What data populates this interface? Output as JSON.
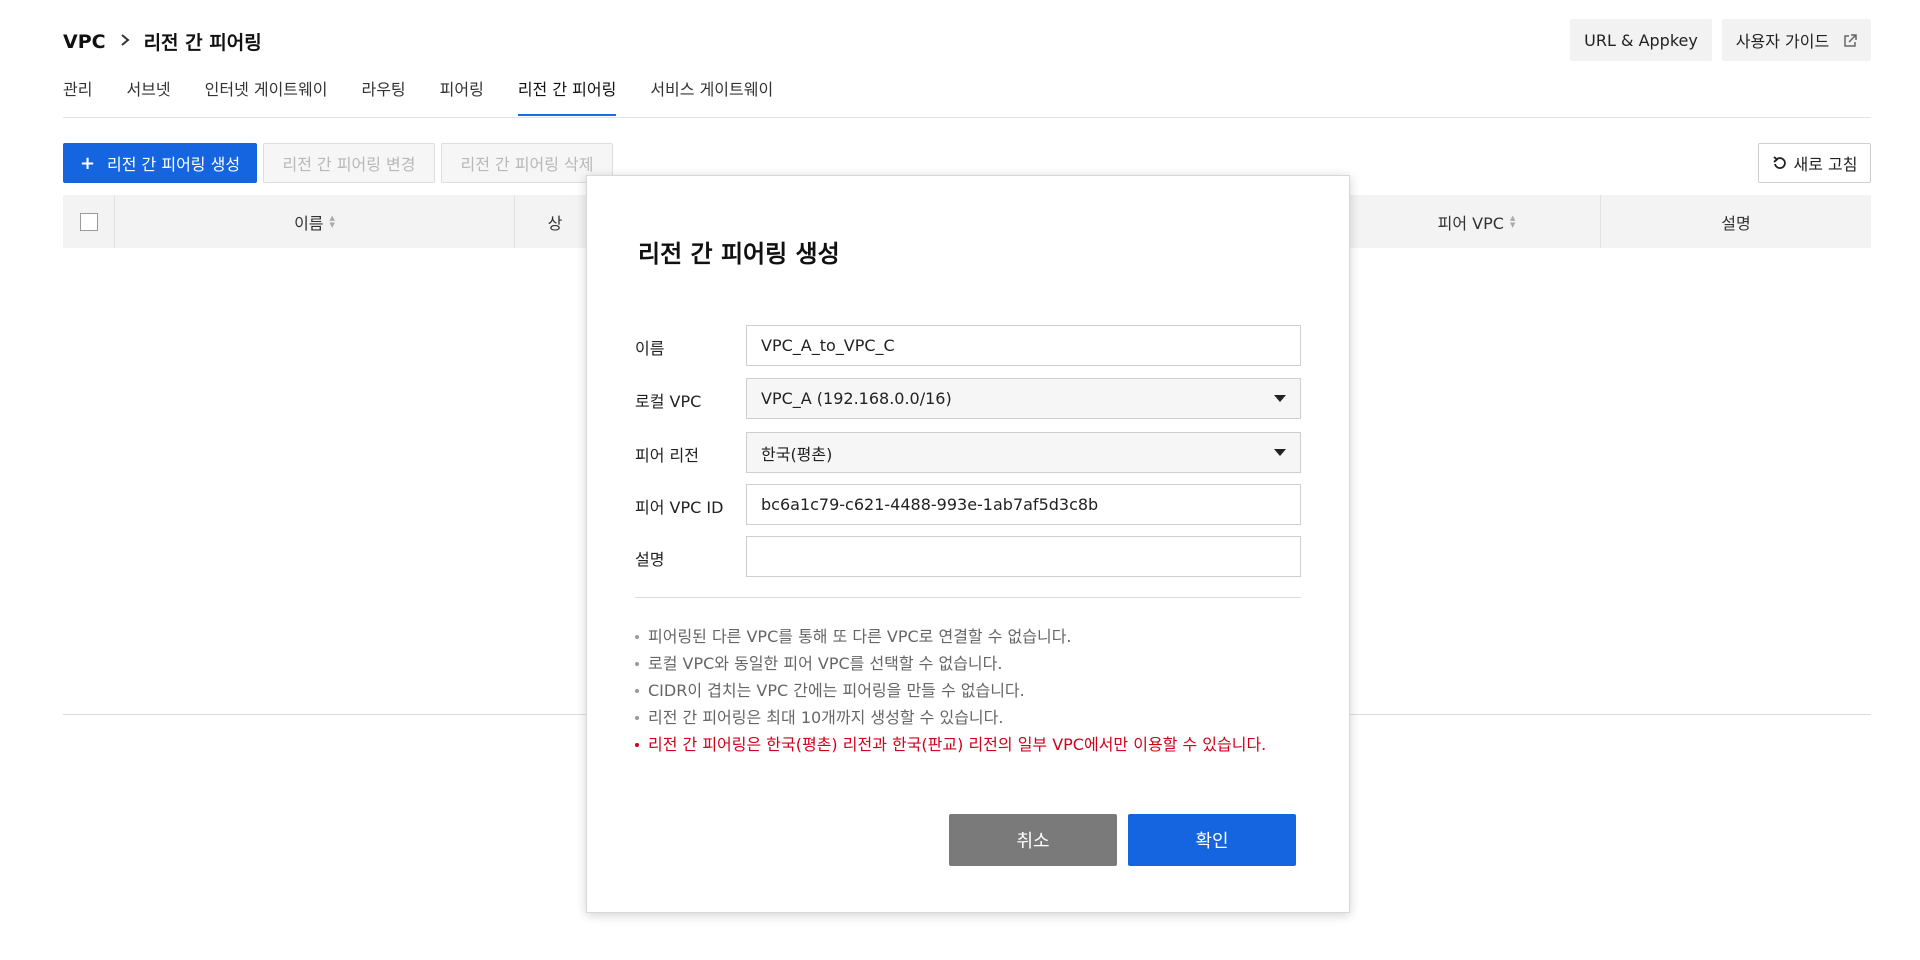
{
  "breadcrumb": {
    "root": "VPC",
    "current": "리전 간 피어링"
  },
  "header_buttons": {
    "url_appkey": "URL & Appkey",
    "user_guide": "사용자 가이드"
  },
  "tabs": [
    {
      "label": "관리",
      "active": false
    },
    {
      "label": "서브넷",
      "active": false
    },
    {
      "label": "인터넷 게이트웨이",
      "active": false
    },
    {
      "label": "라우팅",
      "active": false
    },
    {
      "label": "피어링",
      "active": false
    },
    {
      "label": "리전 간 피어링",
      "active": true
    },
    {
      "label": "서비스 게이트웨이",
      "active": false
    }
  ],
  "toolbar": {
    "create": "리전 간 피어링 생성",
    "edit": "리전 간 피어링 변경",
    "delete": "리전 간 피어링 삭제",
    "refresh": "새로 고침"
  },
  "table": {
    "columns": [
      "이름",
      "상",
      "피어 VPC",
      "설명"
    ]
  },
  "modal": {
    "title": "리전 간 피어링 생성",
    "fields": {
      "name": {
        "label": "이름",
        "value": "VPC_A_to_VPC_C"
      },
      "local_vpc": {
        "label": "로컬 VPC",
        "value": "VPC_A (192.168.0.0/16)"
      },
      "peer_region": {
        "label": "피어 리전",
        "value": "한국(평촌)"
      },
      "peer_vpc_id": {
        "label": "피어 VPC ID",
        "value": "bc6a1c79-c621-4488-993e-1ab7af5d3c8b"
      },
      "description": {
        "label": "설명",
        "value": ""
      }
    },
    "notes": [
      "피어링된 다른 VPC를 통해 또 다른 VPC로 연결할 수 없습니다.",
      "로컬 VPC와 동일한 피어 VPC를 선택할 수 없습니다.",
      "CIDR이 겹치는 VPC 간에는 피어링을 만들 수 없습니다.",
      "리전 간 피어링은 최대 10개까지 생성할 수 있습니다.",
      "리전 간 피어링은 한국(평촌) 리전과 한국(판교) 리전의 일부 VPC에서만 이용할 수 있습니다."
    ],
    "cancel": "취소",
    "confirm": "확인"
  },
  "colors": {
    "primary": "#1565e0",
    "warning": "#d0021b",
    "cancel_button": "#7a7a7a"
  },
  "icons": [
    "chevron-right-icon",
    "external-link-icon",
    "plus-icon",
    "refresh-icon",
    "sort-icon",
    "caret-down-icon"
  ]
}
